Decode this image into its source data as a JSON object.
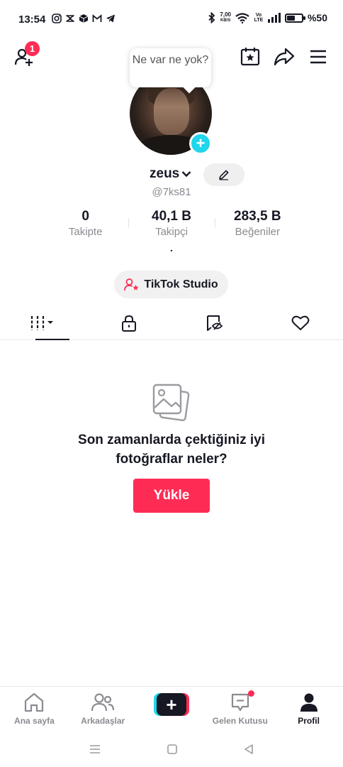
{
  "status_bar": {
    "time": "13:54",
    "net_speed_value": "7,00",
    "net_speed_unit": "KB/S",
    "volte": "Vo LTE",
    "battery_text": "%50",
    "battery_level": 0.5
  },
  "top_bar": {
    "friend_badge": "1",
    "icons": [
      "add-friend-icon",
      "calendar-star-icon",
      "share-icon",
      "menu-icon"
    ]
  },
  "tooltip": {
    "text": "Ne var ne yok?"
  },
  "profile": {
    "username": "zeus",
    "handle": "@7ks81",
    "stats": [
      {
        "value": "0",
        "label": "Takipte"
      },
      {
        "value": "40,1 B",
        "label": "Takipçi"
      },
      {
        "value": "283,5 B",
        "label": "Beğeniler"
      }
    ],
    "bio": ".",
    "studio_button": "TikTok Studio"
  },
  "tabs": [
    "videos-tab",
    "private-tab",
    "reposts-tab",
    "liked-tab"
  ],
  "empty_state": {
    "title": "Son zamanlarda çektiğiniz iyi fotoğraflar neler?",
    "button": "Yükle"
  },
  "bottom_nav": {
    "home": "Ana sayfa",
    "friends": "Arkadaşlar",
    "inbox": "Gelen Kutusu",
    "profile": "Profil"
  },
  "colors": {
    "accent": "#fe2c55",
    "cyan": "#20d5ec",
    "text": "#161823",
    "muted": "#8a8b91"
  }
}
